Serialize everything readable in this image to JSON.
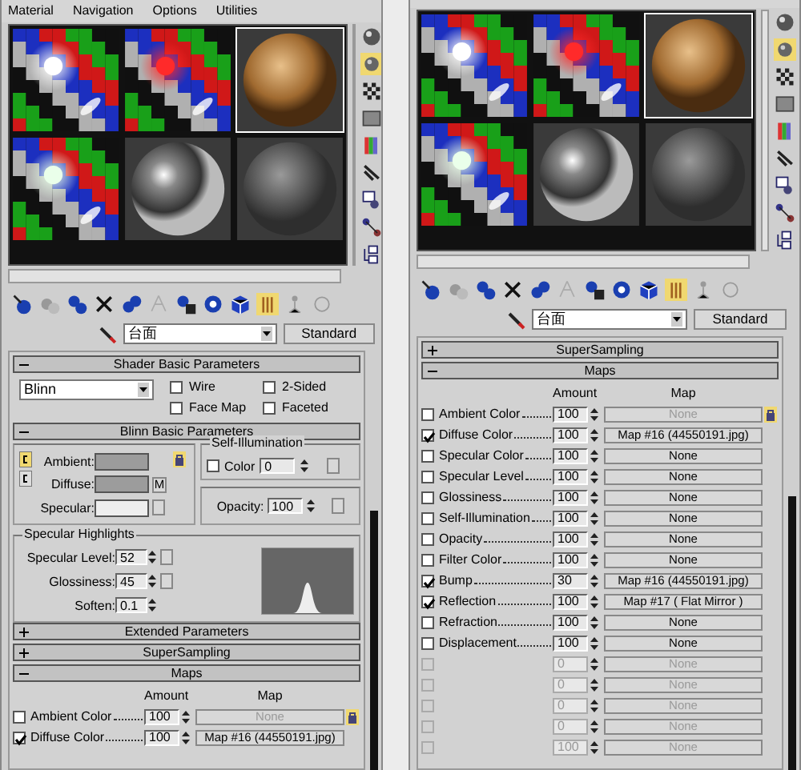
{
  "panels": [
    {
      "menu": [
        "Material",
        "Navigation",
        "Options",
        "Utilities"
      ],
      "slots": [
        {
          "kind": "checker",
          "color": "#ffffff",
          "selected": false
        },
        {
          "kind": "checker",
          "color": "#ff2a2a",
          "selected": false
        },
        {
          "kind": "wood",
          "selected": true
        },
        {
          "kind": "checker",
          "color": "#eaffea",
          "selected": false
        },
        {
          "kind": "chrome",
          "selected": false
        },
        {
          "kind": "gray",
          "selected": false
        }
      ],
      "material_name": "台面",
      "material_type": "Standard",
      "rollouts": [
        {
          "kind": "shader",
          "title": "Shader Basic Parameters",
          "expanded": true,
          "shader": "Blinn",
          "options": [
            {
              "label": "Wire",
              "checked": false
            },
            {
              "label": "2-Sided",
              "checked": false
            },
            {
              "label": "Face Map",
              "checked": false
            },
            {
              "label": "Faceted",
              "checked": false
            }
          ]
        },
        {
          "kind": "blinn",
          "title": "Blinn Basic Parameters",
          "expanded": true,
          "colors": [
            {
              "label": "Ambient:",
              "color": "#9c9c9c"
            },
            {
              "label": "Diffuse:",
              "color": "#9c9c9c"
            },
            {
              "label": "Specular:",
              "color": "#eeeeee"
            }
          ],
          "map_button": "M",
          "self_illumination": {
            "title": "Self-Illumination",
            "label": "Color",
            "checked": false,
            "value": "0"
          },
          "opacity": {
            "label": "Opacity:",
            "value": "100"
          },
          "highlights": {
            "title": "Specular Highlights",
            "params": [
              {
                "label": "Specular Level:",
                "value": "52"
              },
              {
                "label": "Glossiness:",
                "value": "45"
              },
              {
                "label": "Soften:",
                "value": "0.1"
              }
            ]
          }
        },
        {
          "kind": "bar",
          "title": "Extended Parameters",
          "expanded": false
        },
        {
          "kind": "bar",
          "title": "SuperSampling",
          "expanded": false
        },
        {
          "kind": "maps",
          "title": "Maps",
          "expanded": true,
          "columns": [
            "Amount",
            "Map"
          ],
          "rows": [
            {
              "label": "Ambient Color",
              "checked": false,
              "enabled": true,
              "amount": "100",
              "map": "None",
              "map_enabled": false
            },
            {
              "label": "Diffuse Color",
              "checked": true,
              "enabled": true,
              "amount": "100",
              "map": "Map #16 (44550191.jpg)",
              "map_enabled": true
            }
          ]
        }
      ]
    },
    {
      "slots": [
        {
          "kind": "checker",
          "color": "#ffffff",
          "selected": false
        },
        {
          "kind": "checker",
          "color": "#ff2a2a",
          "selected": false
        },
        {
          "kind": "wood",
          "selected": true
        },
        {
          "kind": "checker",
          "color": "#eaffea",
          "selected": false
        },
        {
          "kind": "chrome",
          "selected": false
        },
        {
          "kind": "gray",
          "selected": false
        }
      ],
      "material_name": "台面",
      "material_type": "Standard",
      "rollouts": [
        {
          "kind": "bar",
          "title": "SuperSampling",
          "expanded": false
        },
        {
          "kind": "maps",
          "title": "Maps",
          "expanded": true,
          "columns": [
            "Amount",
            "Map"
          ],
          "rows": [
            {
              "label": "Ambient Color",
              "checked": false,
              "enabled": true,
              "amount": "100",
              "map": "None",
              "map_enabled": false
            },
            {
              "label": "Diffuse Color",
              "checked": true,
              "enabled": true,
              "amount": "100",
              "map": "Map #16 (44550191.jpg)",
              "map_enabled": true
            },
            {
              "label": "Specular Color",
              "checked": false,
              "enabled": true,
              "amount": "100",
              "map": "None",
              "map_enabled": true
            },
            {
              "label": "Specular Level",
              "checked": false,
              "enabled": true,
              "amount": "100",
              "map": "None",
              "map_enabled": true
            },
            {
              "label": "Glossiness",
              "checked": false,
              "enabled": true,
              "amount": "100",
              "map": "None",
              "map_enabled": true
            },
            {
              "label": "Self-Illumination",
              "checked": false,
              "enabled": true,
              "amount": "100",
              "map": "None",
              "map_enabled": true
            },
            {
              "label": "Opacity",
              "checked": false,
              "enabled": true,
              "amount": "100",
              "map": "None",
              "map_enabled": true
            },
            {
              "label": "Filter Color",
              "checked": false,
              "enabled": true,
              "amount": "100",
              "map": "None",
              "map_enabled": true
            },
            {
              "label": "Bump",
              "checked": true,
              "enabled": true,
              "amount": "30",
              "map": "Map #16 (44550191.jpg)",
              "map_enabled": true
            },
            {
              "label": "Reflection",
              "checked": true,
              "enabled": true,
              "amount": "100",
              "map": "Map #17 ( Flat Mirror )",
              "map_enabled": true
            },
            {
              "label": "Refraction",
              "checked": false,
              "enabled": true,
              "amount": "100",
              "map": "None",
              "map_enabled": true
            },
            {
              "label": "Displacement",
              "checked": false,
              "enabled": true,
              "amount": "100",
              "map": "None",
              "map_enabled": true
            },
            {
              "checked": false,
              "enabled": false,
              "amount": "0",
              "map": "None",
              "map_enabled": false
            },
            {
              "checked": false,
              "enabled": false,
              "amount": "0",
              "map": "None",
              "map_enabled": false
            },
            {
              "checked": false,
              "enabled": false,
              "amount": "0",
              "map": "None",
              "map_enabled": false
            },
            {
              "checked": false,
              "enabled": false,
              "amount": "0",
              "map": "None",
              "map_enabled": false
            },
            {
              "checked": false,
              "enabled": false,
              "amount": "100",
              "map": "None",
              "map_enabled": false
            }
          ]
        }
      ]
    }
  ]
}
